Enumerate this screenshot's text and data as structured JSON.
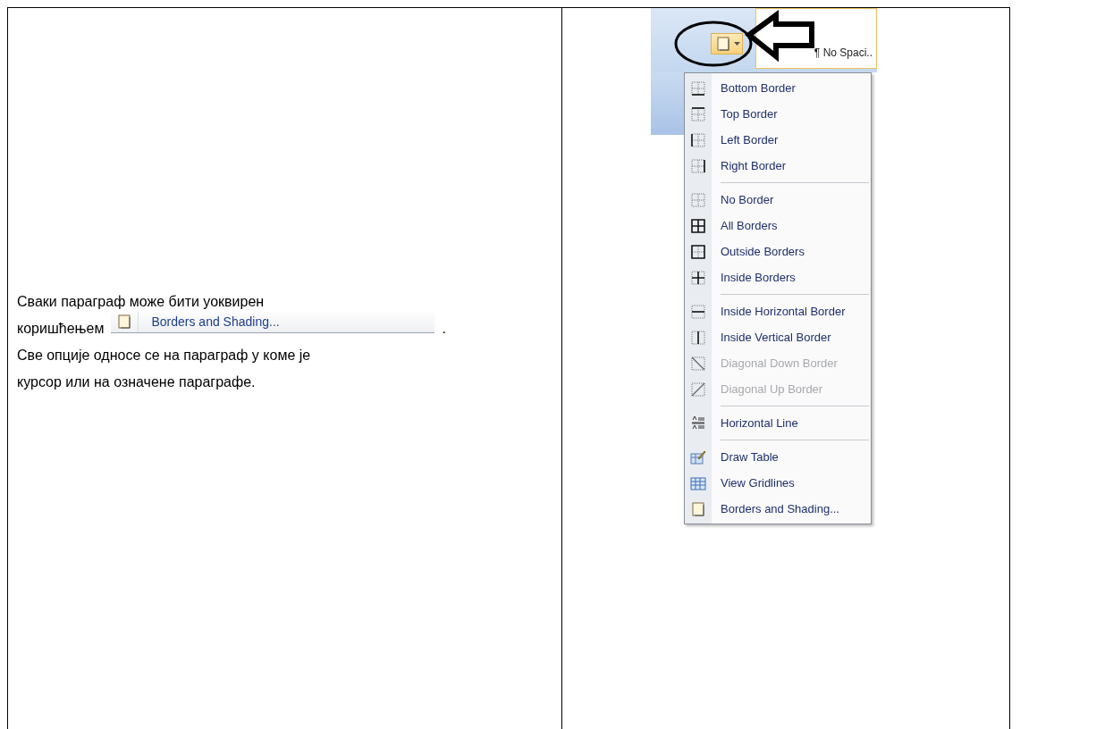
{
  "description": {
    "line_1": "Сваки параграф може бити уоквирен",
    "line_2_before": "коришћењем",
    "inline_button": {
      "label": "Borders and Shading..."
    },
    "line_2_after": ".",
    "line_3": "Све опције односе се на параграф у коме је",
    "line_4": "курсор или на означене параграфе."
  },
  "ribbon": {
    "style_names": [
      "¶ No Spaci.."
    ]
  },
  "menu": {
    "groups": [
      [
        {
          "label": "Bottom Border",
          "disabled": false
        },
        {
          "label": "Top Border",
          "disabled": false
        },
        {
          "label": "Left Border",
          "disabled": false
        },
        {
          "label": "Right Border",
          "disabled": false
        }
      ],
      [
        {
          "label": "No Border",
          "disabled": false
        },
        {
          "label": "All Borders",
          "disabled": false
        },
        {
          "label": "Outside Borders",
          "disabled": false
        },
        {
          "label": "Inside Borders",
          "disabled": false
        }
      ],
      [
        {
          "label": "Inside Horizontal Border",
          "disabled": false
        },
        {
          "label": "Inside Vertical Border",
          "disabled": false
        },
        {
          "label": "Diagonal Down Border",
          "disabled": true
        },
        {
          "label": "Diagonal Up Border",
          "disabled": true
        }
      ],
      [
        {
          "label": "Horizontal Line",
          "disabled": false
        }
      ],
      [
        {
          "label": "Draw Table",
          "disabled": false
        },
        {
          "label": "View Gridlines",
          "disabled": false
        },
        {
          "label": "Borders and Shading...",
          "disabled": false
        }
      ]
    ]
  }
}
